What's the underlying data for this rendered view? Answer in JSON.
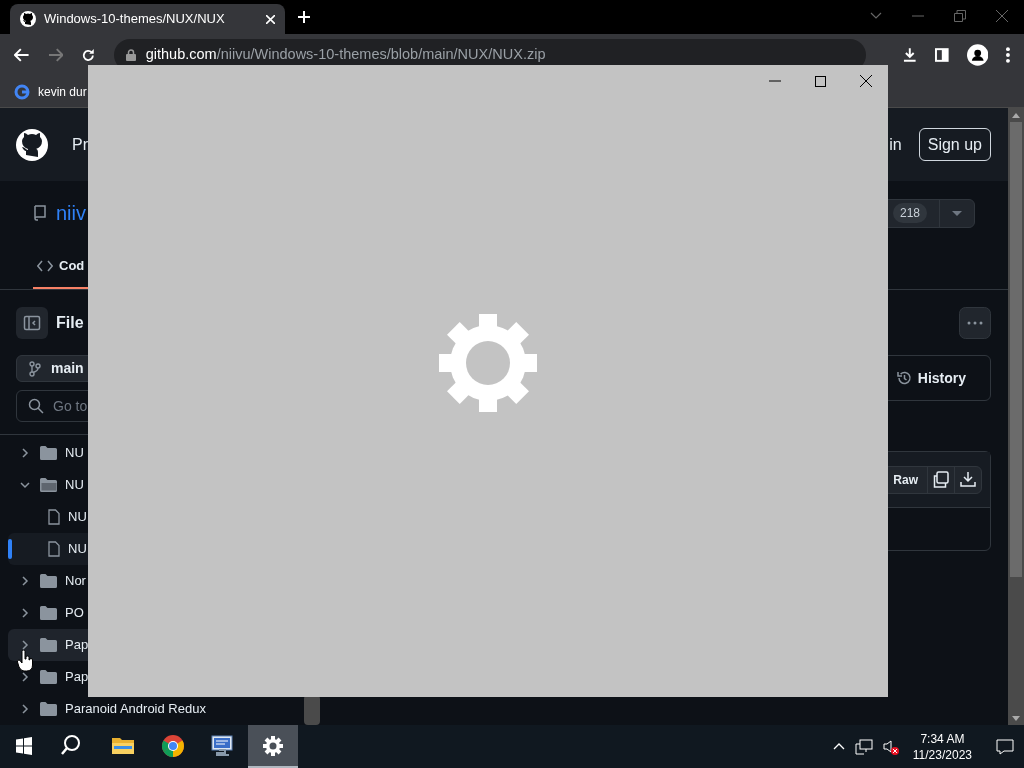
{
  "browser": {
    "tab": {
      "title": "Windows-10-themes/NUX/NUX",
      "selected": true
    },
    "address": {
      "host": "github.com",
      "path": "/niivu/Windows-10-themes/blob/main/NUX/NUX.zip"
    },
    "bookmarks": [
      {
        "label": "kevin dur"
      }
    ]
  },
  "github": {
    "header": {
      "nav_text": "Pr",
      "sign_in": "in",
      "sign_up": "Sign up"
    },
    "repo": {
      "name": "niiv",
      "star_count": "218"
    },
    "tabs": [
      {
        "label": "Cod",
        "selected": true
      }
    ],
    "files": {
      "title": "File",
      "branch": "main",
      "search_placeholder": "Go to"
    },
    "tree": [
      {
        "kind": "folder",
        "label": "NU",
        "expanded": false,
        "selected": false,
        "hovered": false
      },
      {
        "kind": "folder",
        "label": "NU",
        "expanded": true,
        "selected": false,
        "hovered": false,
        "children": [
          {
            "kind": "file",
            "label": "NU",
            "selected": false,
            "hovered": false
          },
          {
            "kind": "file",
            "label": "NU",
            "selected": true,
            "hovered": false
          }
        ]
      },
      {
        "kind": "folder",
        "label": "Nor",
        "expanded": false,
        "selected": false,
        "hovered": false
      },
      {
        "kind": "folder",
        "label": "PO",
        "expanded": false,
        "selected": false,
        "hovered": false
      },
      {
        "kind": "folder",
        "label": "Pap",
        "expanded": false,
        "selected": false,
        "hovered": true
      },
      {
        "kind": "folder",
        "label": "Pap",
        "expanded": false,
        "selected": false,
        "hovered": false
      },
      {
        "kind": "folder",
        "label": "Paranoid Android Redux",
        "expanded": false,
        "selected": false,
        "hovered": false
      }
    ],
    "history": "History",
    "raw": "Raw"
  },
  "taskbar": {
    "apps": [
      {
        "kind": "search",
        "active": false
      },
      {
        "kind": "explorer",
        "active": false
      },
      {
        "kind": "chrome",
        "active": false
      },
      {
        "kind": "remote",
        "active": false
      },
      {
        "kind": "settings",
        "active": true
      }
    ],
    "time": "7:34 AM",
    "date": "11/23/2023"
  }
}
